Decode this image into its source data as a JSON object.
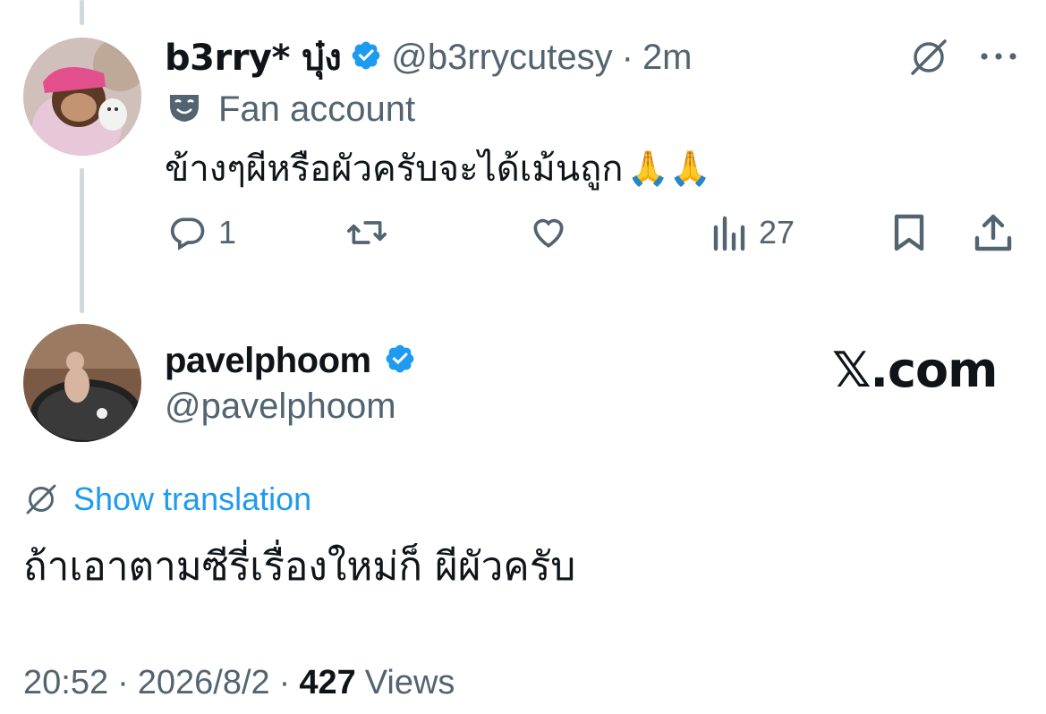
{
  "reply": {
    "display_name": "b3rry* บุ๋ง",
    "handle": "@b3rrycutesy",
    "separator": "·",
    "time": "2m",
    "label_text": "Fan account",
    "text": "ข้างๆผีหรือผัวครับจะได้เม้นถูก",
    "emoji": "🙏🙏",
    "counts": {
      "replies": "1",
      "views": "27"
    }
  },
  "main": {
    "display_name": "pavelphoom",
    "handle": "@pavelphoom",
    "source_label": "𝕏.com",
    "translate_link": "Show translation",
    "text": "ถ้าเอาตามซีรี่เรื่องใหม่ก็ ผีผัวครับ",
    "meta_time": "20:52",
    "meta_date": "2026/8/2",
    "meta_sep1": "·",
    "meta_sep2": "·",
    "views_count": "427",
    "views_label": "Views"
  },
  "colors": {
    "verified": "#1d9bf0",
    "link": "#1d9bf0",
    "muted": "#536471",
    "thread_line": "#cfd9de"
  },
  "icons": [
    "translate-icon",
    "more-icon",
    "theater-mask-icon",
    "reply-icon",
    "retweet-icon",
    "like-icon",
    "views-icon",
    "bookmark-icon",
    "share-icon",
    "verified-badge-icon",
    "translate-icon"
  ]
}
